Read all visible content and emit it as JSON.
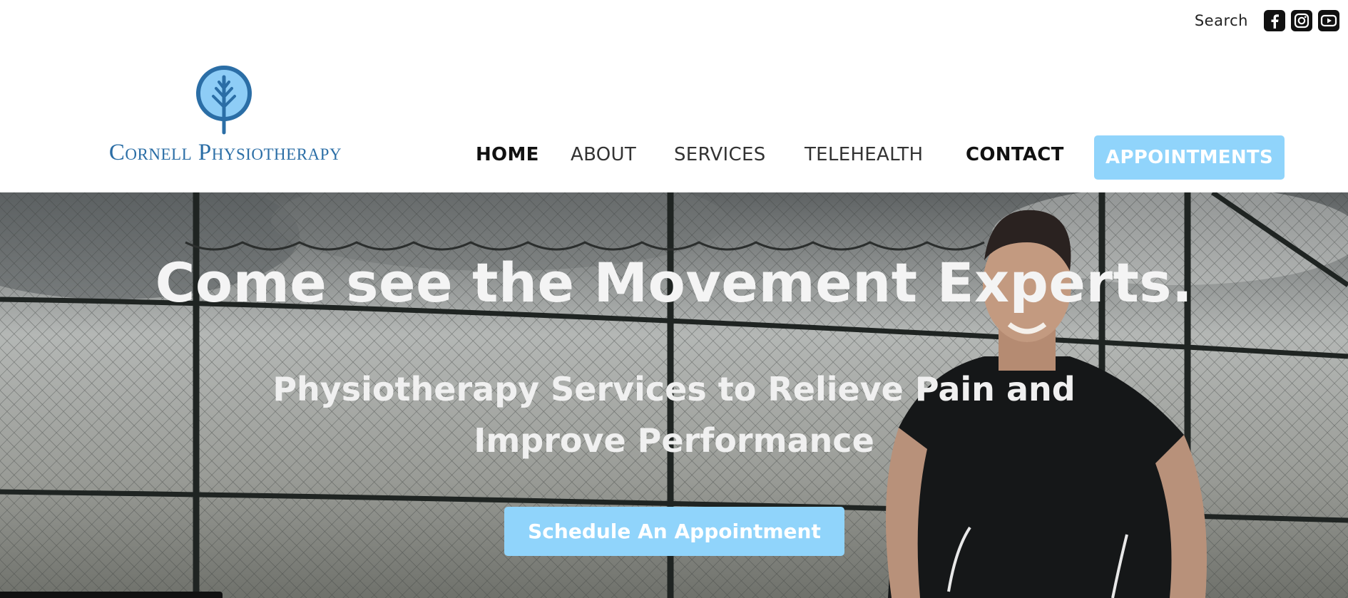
{
  "topbar": {
    "search_label": "Search",
    "social_icons": [
      "facebook-icon",
      "instagram-icon",
      "youtube-icon"
    ]
  },
  "logo": {
    "text": "Cornell Physiotherapy",
    "color": "#2b6ea6",
    "mark_fill": "#8ecdf6"
  },
  "nav": {
    "items": [
      {
        "label": "HOME"
      },
      {
        "label": "ABOUT"
      },
      {
        "label": "SERVICES"
      },
      {
        "label": "TELEHEALTH"
      },
      {
        "label": "CONTACT"
      }
    ],
    "cta_label": "APPOINTMENTS"
  },
  "hero": {
    "title": "Come see the Movement Experts.",
    "subtitle": "Physiotherapy Services to Relieve Pain and Improve Performance",
    "cta_label": "Schedule An Appointment"
  },
  "colors": {
    "accent": "#90d4fb",
    "text_dark": "#111111",
    "hero_text": "#f4f4f4"
  }
}
